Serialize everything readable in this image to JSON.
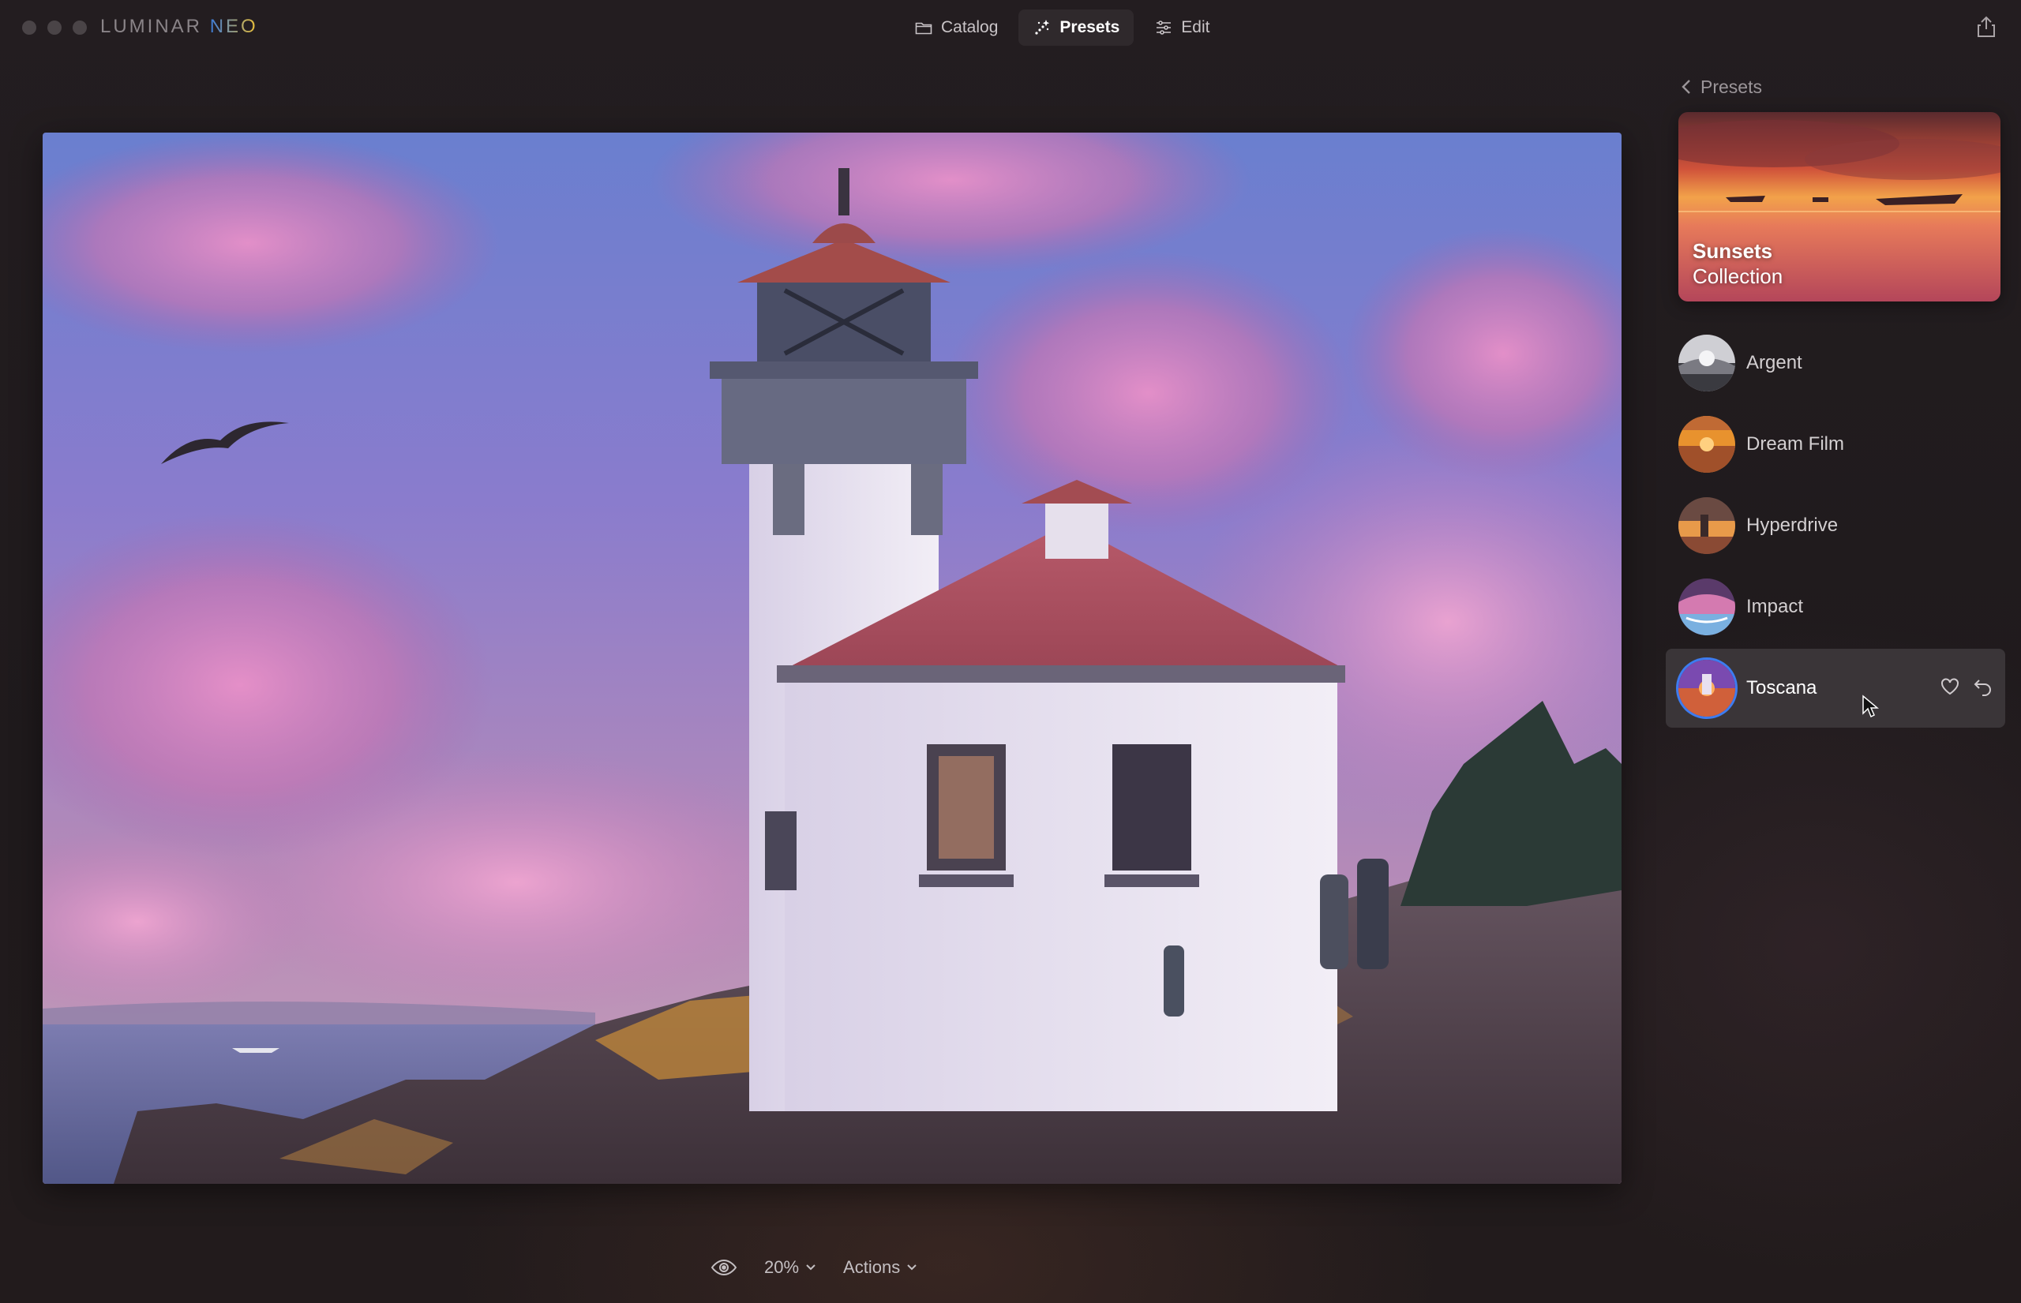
{
  "app": {
    "brand_main": "LUMINAR",
    "brand_accent": "NEO"
  },
  "modes": [
    {
      "label": "Catalog",
      "icon": "folder-icon"
    },
    {
      "label": "Presets",
      "icon": "presets-sparkle-icon",
      "active": true
    },
    {
      "label": "Edit",
      "icon": "sliders-icon"
    }
  ],
  "panel": {
    "back_label": "Presets",
    "collection": {
      "line1": "Sunsets",
      "line2": "Collection"
    },
    "presets": [
      {
        "name": "Argent"
      },
      {
        "name": "Dream Film"
      },
      {
        "name": "Hyperdrive"
      },
      {
        "name": "Impact"
      },
      {
        "name": "Toscana",
        "selected": true
      }
    ]
  },
  "bottombar": {
    "zoom": "20%",
    "actions_label": "Actions"
  },
  "colors": {
    "accent": "#3d7cf0",
    "background": "#1f1a1c",
    "selected_row": "#3a3538"
  }
}
